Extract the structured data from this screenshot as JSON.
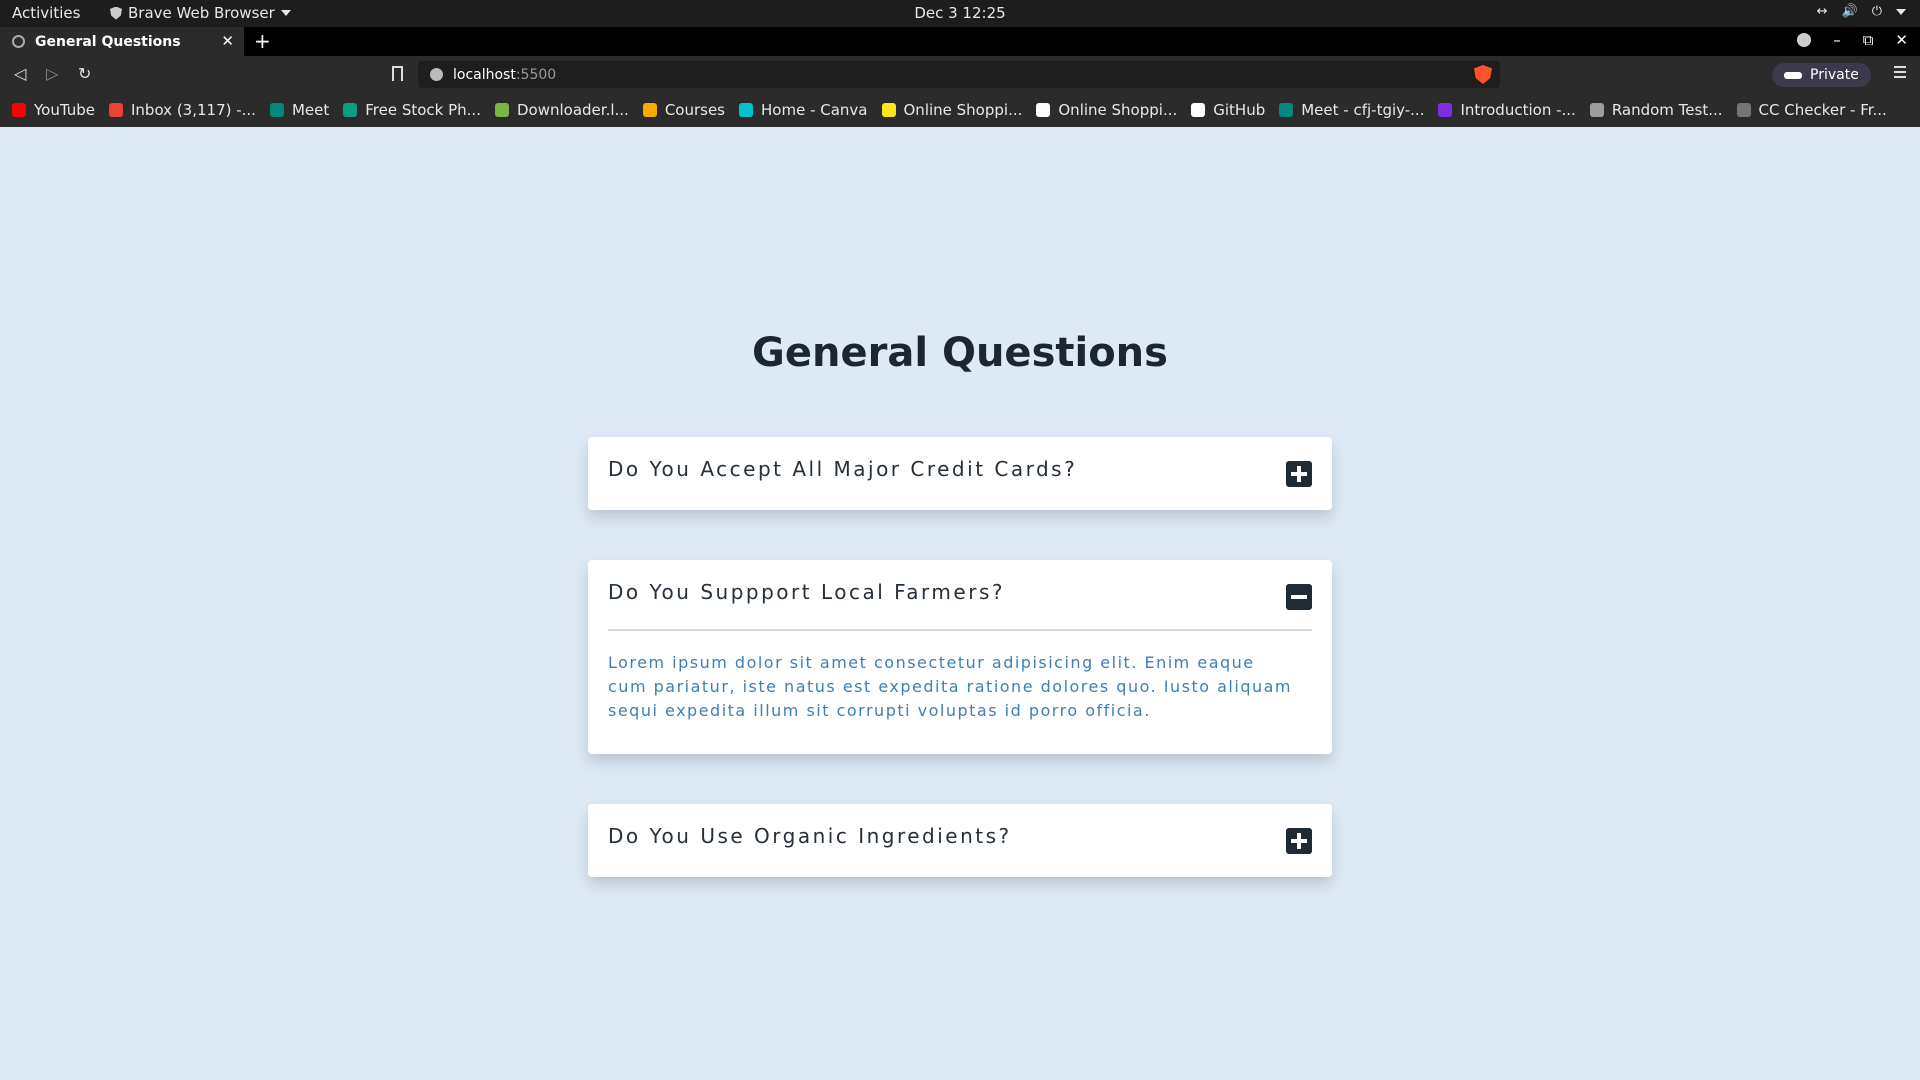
{
  "system_bar": {
    "activities": "Activities",
    "app_name": "Brave Web Browser",
    "clock": "Dec 3  12:25"
  },
  "browser": {
    "tab_title": "General Questions",
    "url_host": "localhost",
    "url_port": ":5500",
    "private_label": "Private",
    "bookmarks": [
      {
        "label": "YouTube",
        "color": "#ff0000"
      },
      {
        "label": "Inbox (3,117) -...",
        "color": "#ea4335"
      },
      {
        "label": "Meet",
        "color": "#00897b"
      },
      {
        "label": "Free Stock Ph...",
        "color": "#05a081"
      },
      {
        "label": "Downloader.l...",
        "color": "#7cb342"
      },
      {
        "label": "Courses",
        "color": "#f9ab00"
      },
      {
        "label": "Home - Canva",
        "color": "#00c4cc"
      },
      {
        "label": "Online Shoppi...",
        "color": "#f8e71c"
      },
      {
        "label": "Online Shoppi...",
        "color": "#ffffff"
      },
      {
        "label": "GitHub",
        "color": "#ffffff"
      },
      {
        "label": "Meet - cfj-tgiy-...",
        "color": "#00897b"
      },
      {
        "label": "Introduction -...",
        "color": "#7b2fe0"
      },
      {
        "label": "Random Test...",
        "color": "#9e9e9e"
      },
      {
        "label": "CC Checker - Fr...",
        "color": "#757575"
      }
    ]
  },
  "faq": {
    "title": "General Questions",
    "items": [
      {
        "question": "Do You Accept All Major Credit Cards?",
        "expanded": false,
        "answer": ""
      },
      {
        "question": "Do You Suppport Local Farmers?",
        "expanded": true,
        "answer": "Lorem ipsum dolor sit amet consectetur adipisicing elit. Enim eaque cum pariatur, iste natus est expedita ratione dolores quo. Iusto aliquam sequi expedita illum sit corrupti voluptas id porro officia."
      },
      {
        "question": "Do You Use Organic Ingredients?",
        "expanded": false,
        "answer": ""
      }
    ]
  },
  "colors": {
    "page_background": "#dde9f5",
    "title_text": "#1b2632",
    "answer_text": "#3e7fb6",
    "toggle_background": "#1f2a35"
  }
}
